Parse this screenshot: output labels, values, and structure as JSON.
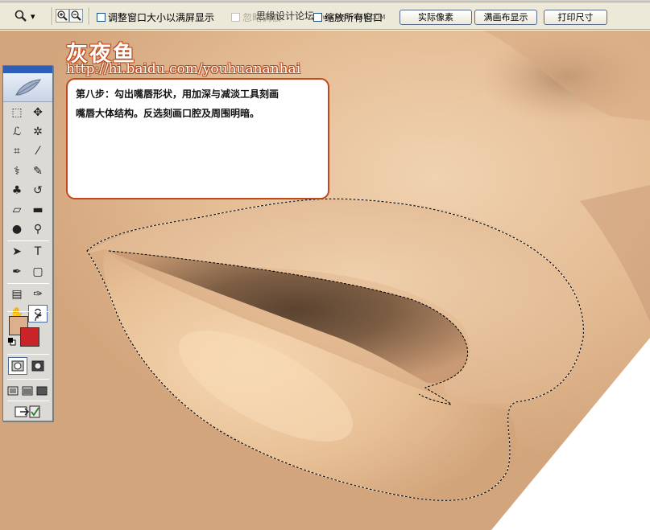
{
  "options_bar": {
    "tool_dropdown_arrow": "▾",
    "zoom_in_icon": "zoom-in-icon",
    "zoom_out_icon": "zoom-out-icon",
    "resize_windows_label": "调整窗口大小以满屏显示",
    "ignore_palettes_label": "忽略调板",
    "zoom_all_windows_label": "缩放所有窗口",
    "actual_pixels_button": "实际像素",
    "fit_screen_button": "满画布显示",
    "print_size_button": "打印尺寸",
    "top_watermark": "思缘设计论坛",
    "top_watermark_url": "www.MISSYUAN.COM"
  },
  "canvas": {
    "brand": "灰夜鱼",
    "url": "http://hi.baidu.com/youhuananhai",
    "note_line1": "第八步：勾出嘴唇形状，用加深与减淡工具刻画",
    "note_line2": "嘴唇大体结构。反选刻画口腔及周围明暗。"
  },
  "toolbox": {
    "tools": [
      {
        "name": "marquee-tool-icon",
        "glyph": "⬚"
      },
      {
        "name": "move-tool-icon",
        "glyph": "✥"
      },
      {
        "name": "lasso-tool-icon",
        "glyph": "ℒ"
      },
      {
        "name": "magic-wand-tool-icon",
        "glyph": "✲"
      },
      {
        "name": "crop-tool-icon",
        "glyph": "⌗"
      },
      {
        "name": "slice-tool-icon",
        "glyph": "⁄"
      },
      {
        "name": "healing-brush-tool-icon",
        "glyph": "⚕"
      },
      {
        "name": "brush-tool-icon",
        "glyph": "✎"
      },
      {
        "name": "clone-stamp-tool-icon",
        "glyph": "♣"
      },
      {
        "name": "history-brush-tool-icon",
        "glyph": "↺"
      },
      {
        "name": "eraser-tool-icon",
        "glyph": "▱"
      },
      {
        "name": "gradient-tool-icon",
        "glyph": "▬"
      },
      {
        "name": "blur-tool-icon",
        "glyph": "●"
      },
      {
        "name": "dodge-tool-icon",
        "glyph": "⚲"
      },
      {
        "name": "path-selection-tool-icon",
        "glyph": "➤"
      },
      {
        "name": "type-tool-icon",
        "glyph": "T"
      },
      {
        "name": "pen-tool-icon",
        "glyph": "✒"
      },
      {
        "name": "shape-tool-icon",
        "glyph": "▢"
      },
      {
        "name": "notes-tool-icon",
        "glyph": "▤"
      },
      {
        "name": "eyedropper-tool-icon",
        "glyph": "✑"
      },
      {
        "name": "hand-tool-icon",
        "glyph": "✋"
      },
      {
        "name": "zoom-tool-icon",
        "glyph": "⚲"
      }
    ],
    "foreground_color": "#dcb08c",
    "background_color": "#c8242a",
    "quickmask_off_icon": "standard-mode-icon",
    "quickmask_on_icon": "quick-mask-mode-icon",
    "jump_to_imageready_icon": "imageready-icon"
  }
}
